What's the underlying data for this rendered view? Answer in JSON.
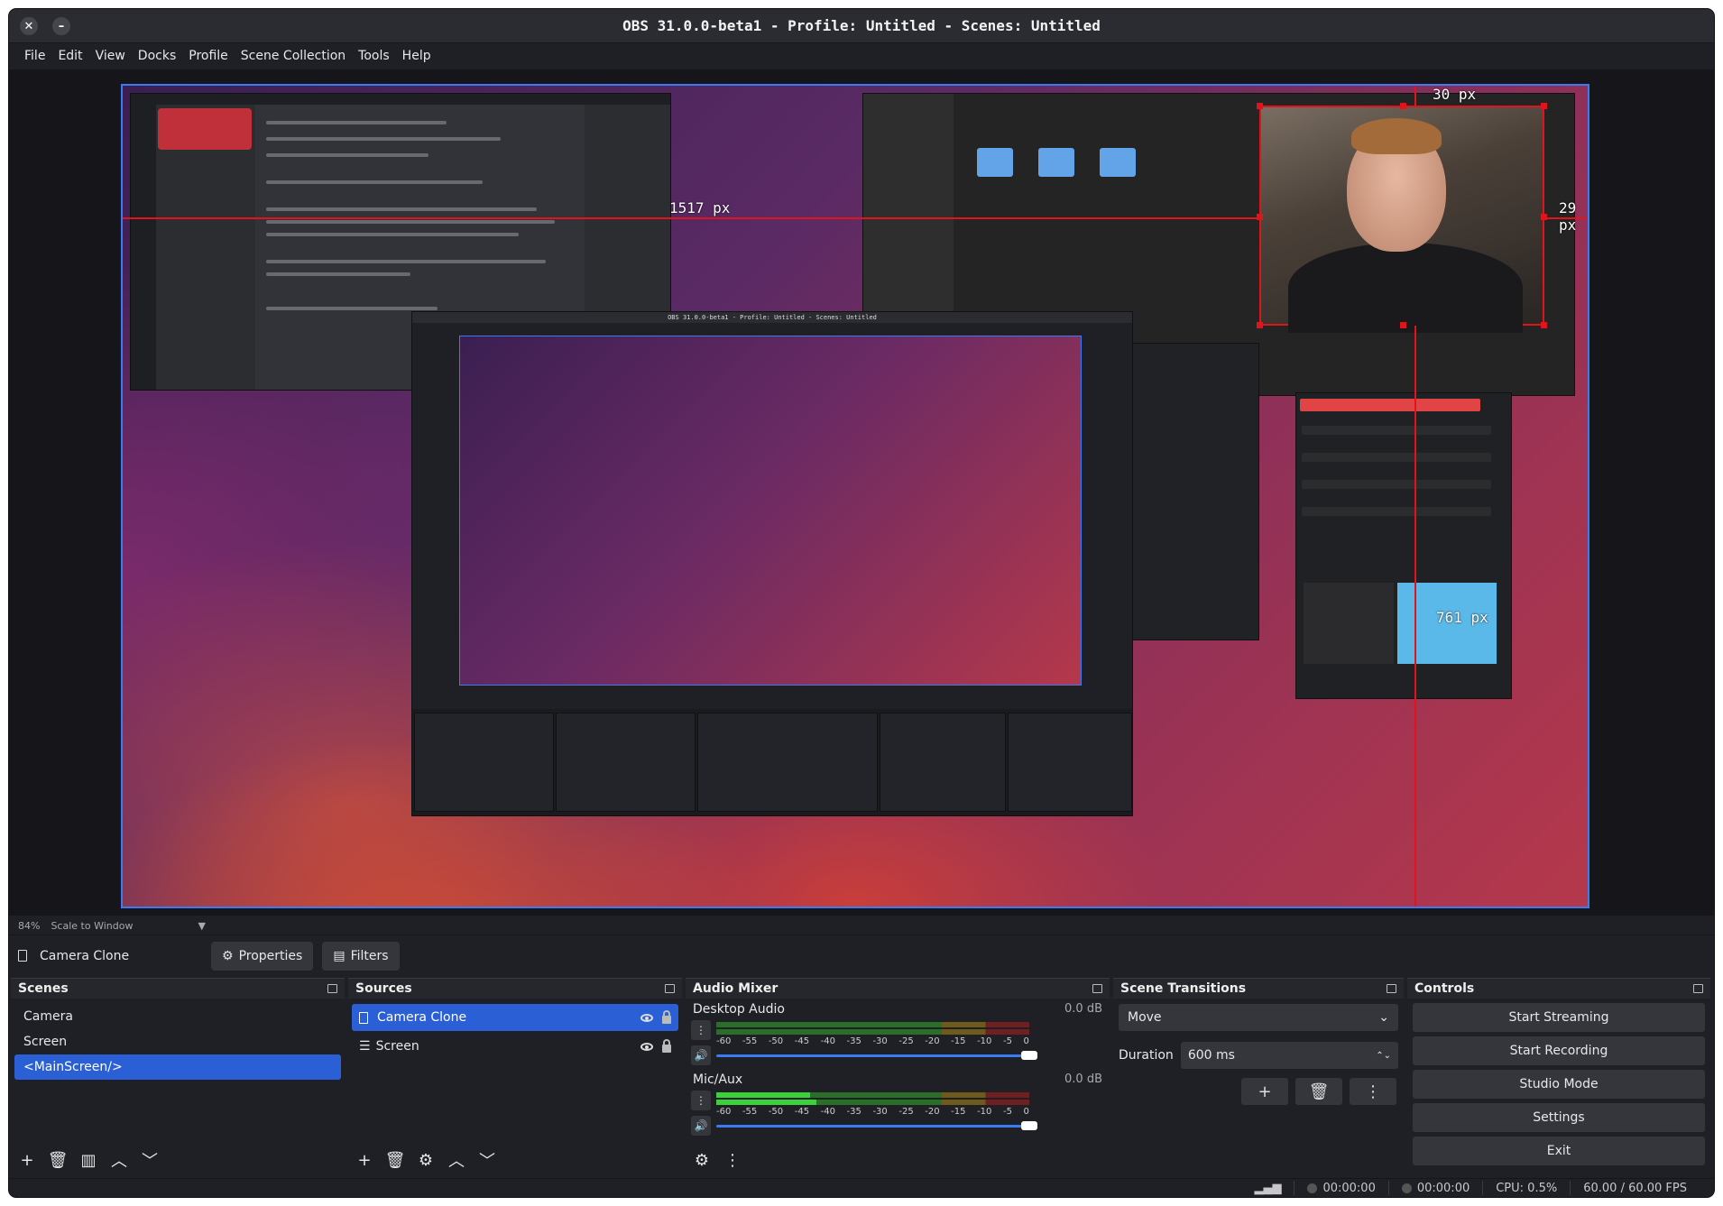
{
  "window": {
    "title": "OBS 31.0.0-beta1 - Profile: Untitled - Scenes: Untitled"
  },
  "menu": [
    "File",
    "Edit",
    "View",
    "Docks",
    "Profile",
    "Scene Collection",
    "Tools",
    "Help"
  ],
  "preview": {
    "measure_left": "1517 px",
    "measure_top": "30 px",
    "measure_right": "29 px",
    "measure_bottom": "761 px"
  },
  "scale": {
    "zoom": "84%",
    "mode": "Scale to Window"
  },
  "source_toolbar": {
    "current_source": "Camera Clone",
    "properties": "Properties",
    "filters": "Filters"
  },
  "scenes": {
    "title": "Scenes",
    "items": [
      "Camera",
      "Screen",
      "<MainScreen/>"
    ],
    "selected": 2
  },
  "sources": {
    "title": "Sources",
    "items": [
      {
        "label": "Camera Clone",
        "selected": true
      },
      {
        "label": "Screen",
        "selected": false
      }
    ]
  },
  "mixer": {
    "title": "Audio Mixer",
    "channels": [
      {
        "name": "Desktop Audio",
        "db": "0.0 dB",
        "level": 0
      },
      {
        "name": "Mic/Aux",
        "db": "0.0 dB",
        "level": 0.3
      }
    ],
    "ticks": [
      "-60",
      "-55",
      "-50",
      "-45",
      "-40",
      "-35",
      "-30",
      "-25",
      "-20",
      "-15",
      "-10",
      "-5",
      "0"
    ]
  },
  "transitions": {
    "title": "Scene Transitions",
    "type": "Move",
    "duration_label": "Duration",
    "duration": "600 ms"
  },
  "controls": {
    "title": "Controls",
    "buttons": [
      "Start Streaming",
      "Start Recording",
      "Studio Mode",
      "Settings",
      "Exit"
    ]
  },
  "status": {
    "stream_time": "00:00:00",
    "rec_time": "00:00:00",
    "cpu": "CPU: 0.5%",
    "fps": "60.00 / 60.00 FPS"
  },
  "colors": {
    "accent": "#2a5fd6",
    "guide": "#e0141a",
    "canvas_border": "#3a7bf1"
  }
}
